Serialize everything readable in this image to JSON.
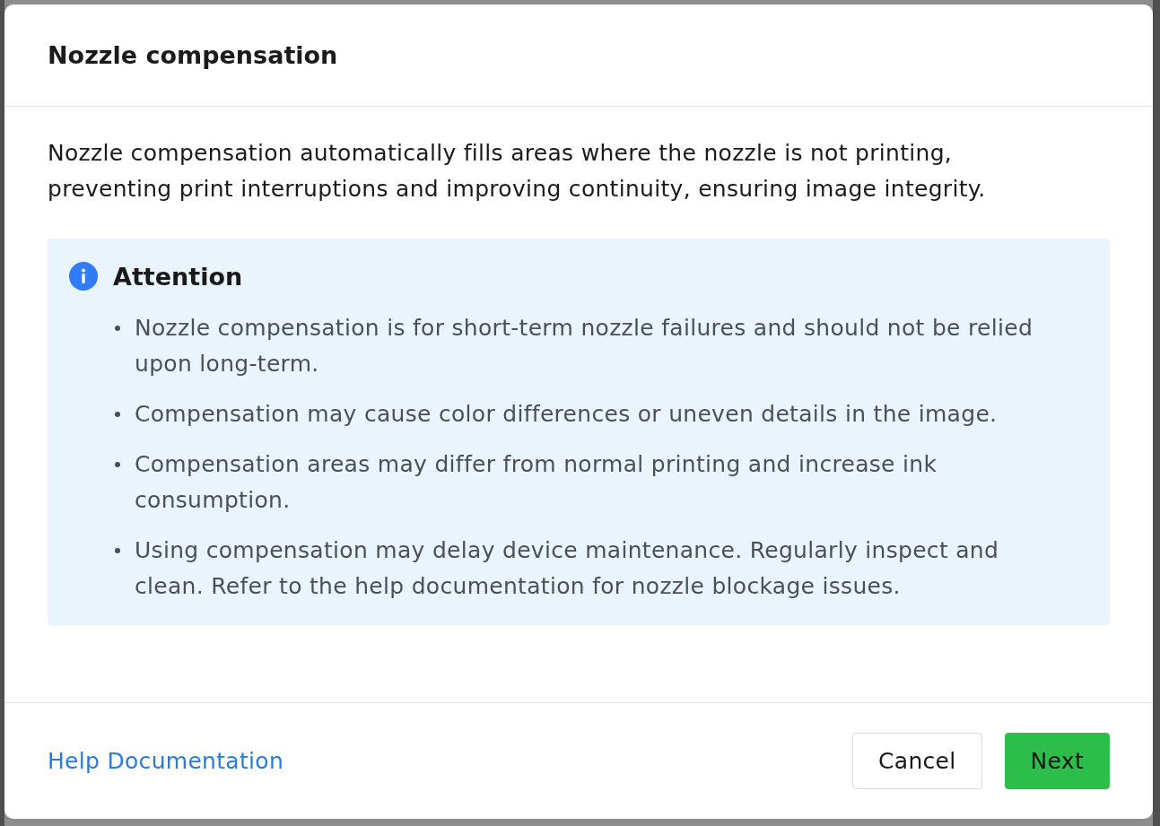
{
  "dialog": {
    "title": "Nozzle compensation",
    "description": "Nozzle compensation automatically fills areas where the nozzle is not printing, preventing print interruptions and improving continuity, ensuring image integrity.",
    "notice": {
      "kind": "info",
      "title": "Attention",
      "items": [
        "Nozzle compensation is for short-term nozzle failures and should not be relied upon long-term.",
        "Compensation may cause color differences or uneven details in the image.",
        "Compensation areas may differ from normal printing and increase ink consumption.",
        "Using compensation may delay device maintenance. Regularly inspect and clean. Refer to the help documentation for nozzle blockage issues."
      ]
    },
    "footer": {
      "help_link": "Help Documentation",
      "buttons": [
        {
          "label": "Cancel",
          "kind": "secondary"
        },
        {
          "label": "Next",
          "kind": "primary"
        }
      ]
    }
  }
}
